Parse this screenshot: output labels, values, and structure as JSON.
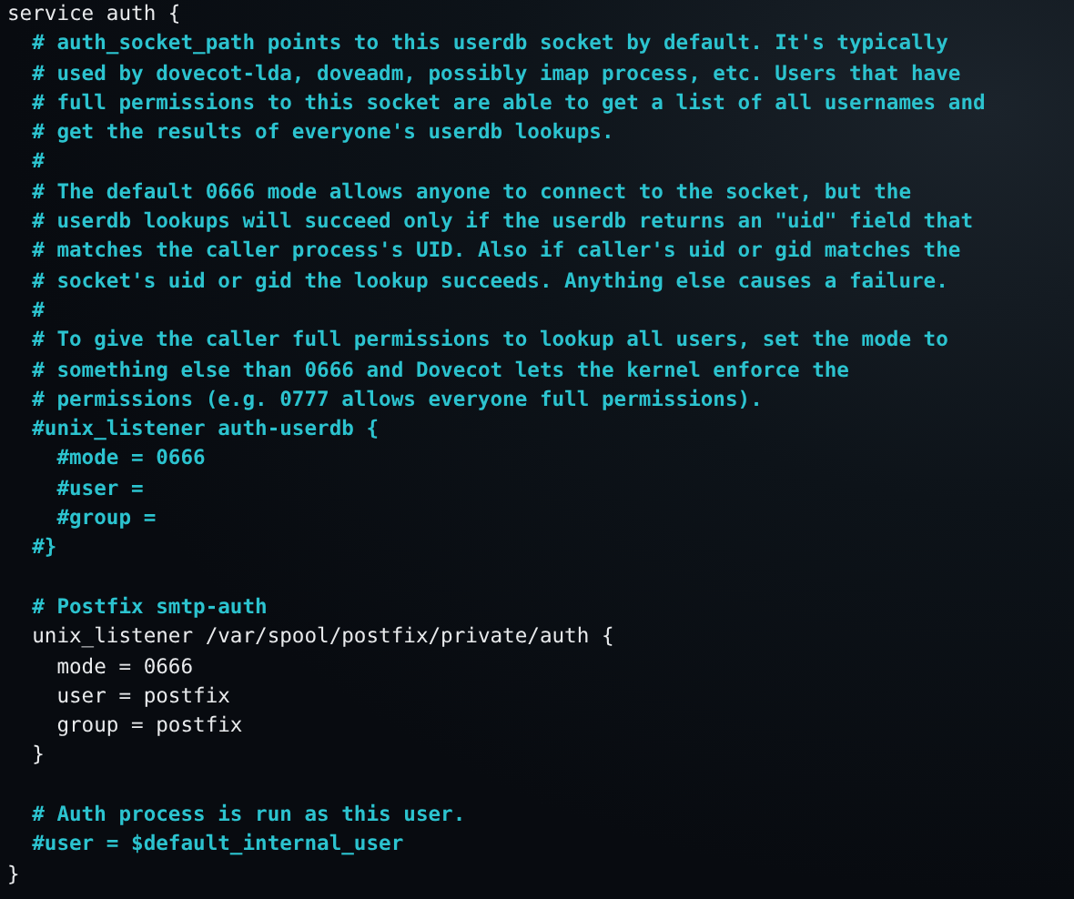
{
  "terminal": {
    "lines": [
      {
        "kind": "code",
        "text": "service auth {"
      },
      {
        "kind": "comment",
        "text": "  # auth_socket_path points to this userdb socket by default. It's typically"
      },
      {
        "kind": "comment",
        "text": "  # used by dovecot-lda, doveadm, possibly imap process, etc. Users that have"
      },
      {
        "kind": "comment",
        "text": "  # full permissions to this socket are able to get a list of all usernames and"
      },
      {
        "kind": "comment",
        "text": "  # get the results of everyone's userdb lookups."
      },
      {
        "kind": "comment",
        "text": "  #"
      },
      {
        "kind": "comment",
        "text": "  # The default 0666 mode allows anyone to connect to the socket, but the"
      },
      {
        "kind": "comment",
        "text": "  # userdb lookups will succeed only if the userdb returns an \"uid\" field that"
      },
      {
        "kind": "comment",
        "text": "  # matches the caller process's UID. Also if caller's uid or gid matches the"
      },
      {
        "kind": "comment",
        "text": "  # socket's uid or gid the lookup succeeds. Anything else causes a failure."
      },
      {
        "kind": "comment",
        "text": "  #"
      },
      {
        "kind": "comment",
        "text": "  # To give the caller full permissions to lookup all users, set the mode to"
      },
      {
        "kind": "comment",
        "text": "  # something else than 0666 and Dovecot lets the kernel enforce the"
      },
      {
        "kind": "comment",
        "text": "  # permissions (e.g. 0777 allows everyone full permissions)."
      },
      {
        "kind": "comment",
        "text": "  #unix_listener auth-userdb {"
      },
      {
        "kind": "comment",
        "text": "    #mode = 0666"
      },
      {
        "kind": "comment",
        "text": "    #user = "
      },
      {
        "kind": "comment",
        "text": "    #group = "
      },
      {
        "kind": "comment",
        "text": "  #}"
      },
      {
        "kind": "blank"
      },
      {
        "kind": "comment",
        "text": "  # Postfix smtp-auth"
      },
      {
        "kind": "code",
        "text": "  unix_listener /var/spool/postfix/private/auth {"
      },
      {
        "kind": "code",
        "text": "    mode = 0666"
      },
      {
        "kind": "code",
        "text": "    user = postfix"
      },
      {
        "kind": "code",
        "text": "    group = postfix"
      },
      {
        "kind": "code",
        "text": "  }"
      },
      {
        "kind": "blank"
      },
      {
        "kind": "comment",
        "text": "  # Auth process is run as this user."
      },
      {
        "kind": "comment",
        "text": "  #user = $default_internal_user"
      },
      {
        "kind": "code",
        "text": "}"
      }
    ]
  }
}
